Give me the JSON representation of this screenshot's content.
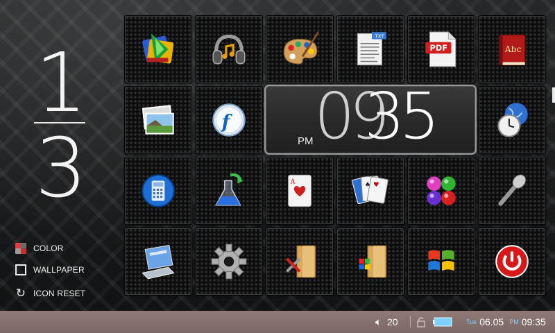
{
  "page_indicator": {
    "current": "1",
    "total": "3"
  },
  "side_options": [
    {
      "label": "COLOR",
      "icon": "color-icon"
    },
    {
      "label": "WALLPAPER",
      "icon": "wallpaper-icon"
    },
    {
      "label": "ICON RESET",
      "icon": "reset-icon"
    }
  ],
  "tiles": [
    "media-player-icon",
    "music-headphones-icon",
    "paint-palette-icon",
    "txt-viewer-icon",
    "pdf-viewer-icon",
    "dictionary-icon",
    "photo-viewer-icon",
    "flash-player-icon",
    "world-clock-icon",
    "calculator-icon",
    "chemistry-flask-icon",
    "card-game-icon",
    "solitaire-cards-icon",
    "color-balls-game-icon",
    "microphone-icon",
    "file-viewer-icon",
    "settings-gear-icon",
    "tools-folder-icon",
    "windows-folder-icon",
    "windows-logo-icon",
    "power-icon"
  ],
  "clock": {
    "ampm": "PM",
    "hour": "09",
    "minute": "35"
  },
  "status_bar": {
    "volume": "20",
    "day": "Tue",
    "date": "06.05",
    "ampm": "PM",
    "time": "09:35"
  },
  "colors": {
    "taskbar": "#86716d",
    "tile_border": "#3a3b3c",
    "accent_blue": "#7fd0ff"
  }
}
